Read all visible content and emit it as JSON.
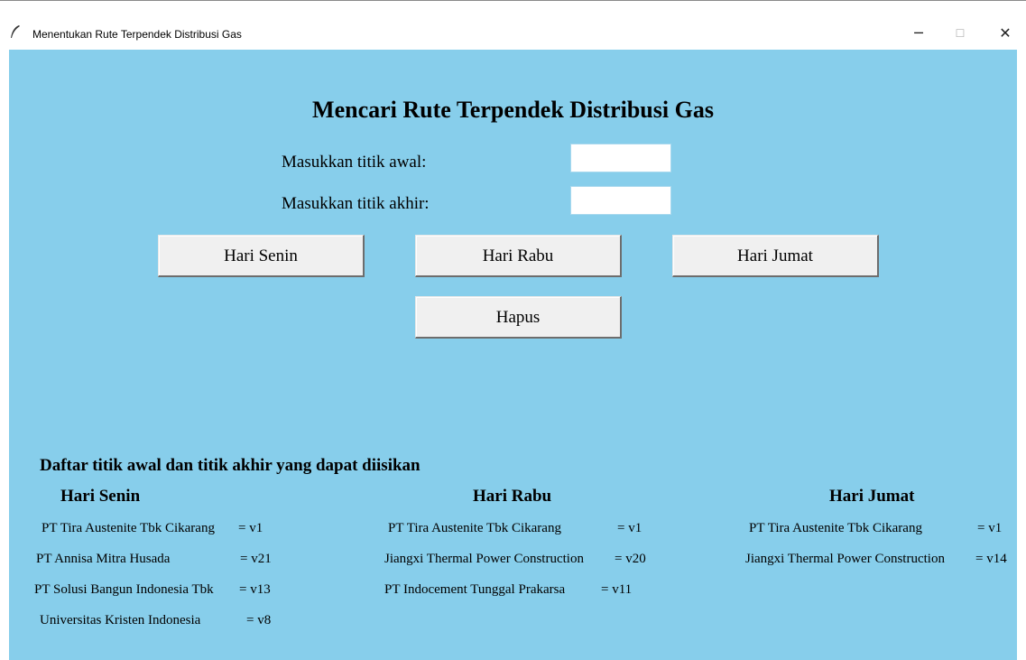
{
  "window": {
    "title": "Menentukan Rute Terpendek Distribusi Gas",
    "controls": {
      "minimize": "─",
      "maximize": "☐",
      "close": "✕"
    }
  },
  "form": {
    "heading": "Mencari Rute Terpendek Distribusi Gas",
    "start_label": "Masukkan titik awal:",
    "start_value": "",
    "end_label": "Masukkan titik akhir:",
    "end_value": ""
  },
  "buttons": {
    "senin": "Hari Senin",
    "rabu": "Hari Rabu",
    "jumat": "Hari Jumat",
    "hapus": "Hapus"
  },
  "list": {
    "title": "Daftar titik awal dan titik akhir yang dapat diisikan",
    "senin": {
      "heading": "Hari Senin",
      "items": [
        {
          "name": "PT Tira Austenite Tbk Cikarang",
          "value": "= v1"
        },
        {
          "name": "PT Annisa Mitra Husada",
          "value": "= v21"
        },
        {
          "name": "PT Solusi Bangun Indonesia Tbk",
          "value": "= v13"
        },
        {
          "name": "Universitas Kristen Indonesia",
          "value": "= v8"
        }
      ]
    },
    "rabu": {
      "heading": "Hari Rabu",
      "items": [
        {
          "name": "PT Tira Austenite Tbk Cikarang",
          "value": "= v1"
        },
        {
          "name": "Jiangxi Thermal Power Construction",
          "value": "= v20"
        },
        {
          "name": "PT Indocement Tunggal Prakarsa",
          "value": "= v11"
        }
      ]
    },
    "jumat": {
      "heading": "Hari Jumat",
      "items": [
        {
          "name": "PT Tira Austenite Tbk Cikarang",
          "value": "= v1"
        },
        {
          "name": "Jiangxi Thermal Power Construction",
          "value": "= v14"
        }
      ]
    }
  },
  "colors": {
    "background": "#87ceeb",
    "button": "#f0f0f0"
  }
}
